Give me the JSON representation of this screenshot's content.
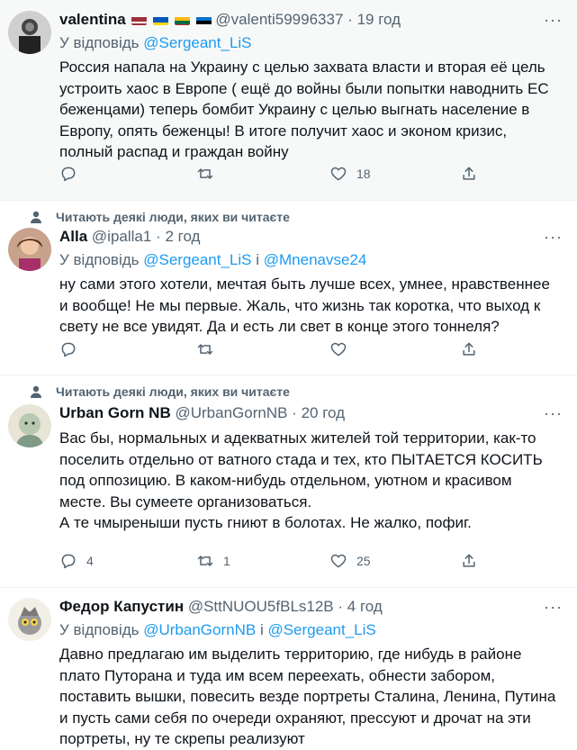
{
  "tweets": [
    {
      "name": "valentina",
      "handle": "@valenti59996337",
      "time": "19 год",
      "reply_prefix": "У відповідь",
      "reply_mentions": "@Sergeant_LiS",
      "reply_join": "",
      "text": [
        "Россия напала на Украину с целью захвата власти и вторая её цель",
        "устроить хаос в Европе ( ещё до войны были попытки наводнить ЕС",
        "беженцами) теперь бомбит Украину с целью выгнать население в",
        "Европу, опять беженцы! В итоге получит хаос и эконом кризис,",
        "полный распад и граждан войну"
      ],
      "counts": {
        "reply": "",
        "retweet": "",
        "like": "18"
      }
    },
    {
      "social_context": "Читають деякі люди, яких ви читаєте",
      "name": "Alla",
      "handle": "@ipalla1",
      "time": "2 год",
      "reply_prefix": "У відповідь",
      "reply_mentions": "@Sergeant_LiS",
      "reply_join": "і",
      "reply_mentions2": "@Mnenavse24",
      "text": [
        "ну сами этого хотели, мечтая быть лучше всех, умнее, нравственнее",
        "и вообще! Не мы первые. Жаль, что жизнь так коротка, что выход к",
        "свету не все увидят. Да и есть ли свет в конце этого тоннеля?"
      ],
      "counts": {
        "reply": "",
        "retweet": "",
        "like": ""
      }
    },
    {
      "social_context": "Читають деякі люди, яких ви читаєте",
      "name": "Urban Gorn NB",
      "handle": "@UrbanGornNB",
      "time": "20 год",
      "text": [
        "Вас бы, нормальных и адекватных жителей той территории, как-то",
        "поселить отдельно от ватного стада и тех, кто ПЫТАЕТСЯ КОСИТЬ",
        "под оппозицию. В каком-нибудь отдельном, уютном и красивом",
        "месте. Вы сумеете организоваться.",
        "А те чмыреныши пусть гниют в болотах. Не жалко, пофиг."
      ],
      "counts": {
        "reply": "4",
        "retweet": "1",
        "like": "25"
      }
    },
    {
      "name": "Федор Капустин",
      "handle": "@SttNUOU5fBLs12B",
      "time": "4 год",
      "reply_prefix": "У відповідь",
      "reply_mentions": "@UrbanGornNB",
      "reply_join": "і",
      "reply_mentions2": "@Sergeant_LiS",
      "text": [
        "Давно предлагаю им выделить территорию, где нибудь в районе",
        "плато Путорана и туда им всем переехать, обнести забором,",
        "поставить вышки, повесить везде портреты Сталина, Ленина, Путина",
        "и пусть сами себя по очереди охраняют, прессуют и дрочат на эти",
        "портреты, ну те скрепы реализуют"
      ]
    }
  ],
  "ui": {
    "dot": "·",
    "more": "···"
  },
  "colors": {
    "accent": "#1d9bf0",
    "muted": "#536471",
    "text": "#0f1419"
  },
  "icons": {
    "reply": "reply-icon",
    "retweet": "retweet-icon",
    "like": "heart-icon",
    "share": "share-icon",
    "more": "more-icon",
    "social": "person-icon"
  }
}
